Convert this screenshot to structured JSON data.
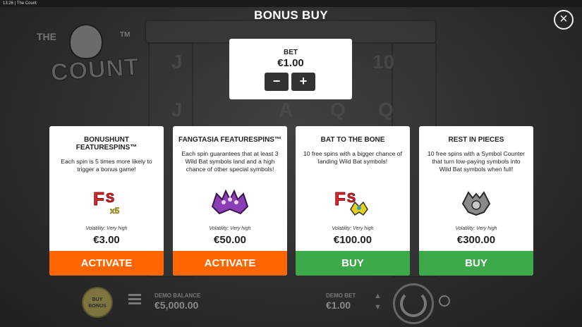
{
  "window": {
    "time": "13:26",
    "app_title": "The Count"
  },
  "logo": {
    "the": "THE",
    "name": "COUNT",
    "tm": "TM"
  },
  "header": {
    "title": "BONUS BUY"
  },
  "bet": {
    "label": "BET",
    "value": "€1.00",
    "minus": "−",
    "plus": "+"
  },
  "cards": [
    {
      "title": "BONUSHUNT FEATURESPINS™",
      "description": "Each spin is 5 times more likely to trigger a bonus game!",
      "volatility": "Volatility: Very high",
      "price": "€3.00",
      "button": "ACTIVATE",
      "button_color": "#ff6600",
      "icon": "fs-x5-icon",
      "icon_text": "x5"
    },
    {
      "title": "FANGTASIA FEATURESPINS™",
      "description": "Each spin guarantees that at least 3 Wild Bat symbols land and a high chance of other special symbols!",
      "volatility": "Volatility: Very high",
      "price": "€50.00",
      "button": "ACTIVATE",
      "button_color": "#ff6600",
      "icon": "purple-bats-icon"
    },
    {
      "title": "BAT TO THE BONE",
      "description": "10 free spins with a bigger chance of landing Wild Bat symbols!",
      "volatility": "Volatility: Very high",
      "price": "€100.00",
      "button": "BUY",
      "button_color": "#3daa49",
      "icon": "fs-bat-icon"
    },
    {
      "title": "REST IN PIECES",
      "description": "10 free spins with a Symbol Counter that turn low-paying symbols into Wild Bat symbols when full!",
      "volatility": "Volatility: Very high",
      "price": "€300.00",
      "button": "BUY",
      "button_color": "#3daa49",
      "icon": "grey-bat-icon"
    }
  ],
  "bottom_bar": {
    "bonus_button": "BUY BONUS",
    "balance_label": "DEMO BALANCE",
    "balance_value": "€5,000.00",
    "bet_label": "DEMO BET",
    "bet_value": "€1.00"
  },
  "background_letters": [
    "J",
    "10",
    "J",
    "A",
    "Q",
    "Q"
  ]
}
